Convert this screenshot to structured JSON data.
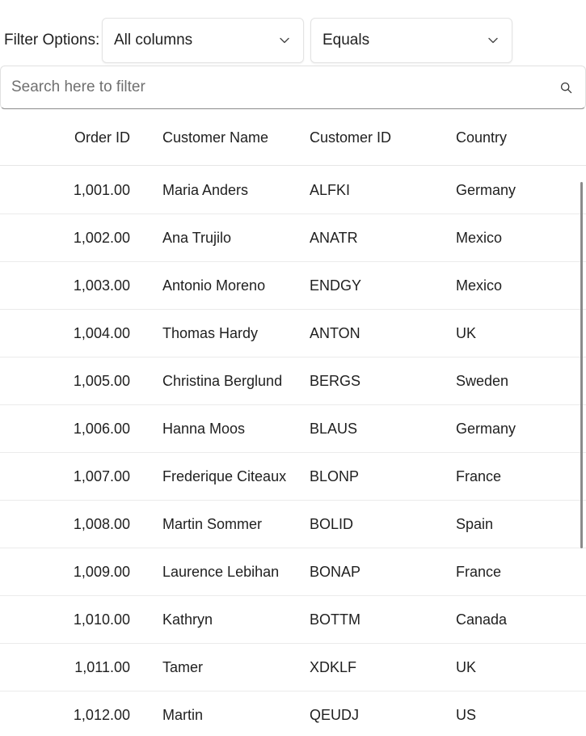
{
  "filter": {
    "label": "Filter Options:",
    "column_value": "All columns",
    "condition_value": "Equals"
  },
  "search": {
    "placeholder": "Search here to filter"
  },
  "grid": {
    "columns": [
      "Order ID",
      "Customer Name",
      "Customer ID",
      "Country"
    ],
    "rows": [
      [
        "1,001.00",
        "Maria Anders",
        "ALFKI",
        "Germany"
      ],
      [
        "1,002.00",
        "Ana Trujilo",
        "ANATR",
        "Mexico"
      ],
      [
        "1,003.00",
        "Antonio Moreno",
        "ENDGY",
        "Mexico"
      ],
      [
        "1,004.00",
        "Thomas Hardy",
        "ANTON",
        "UK"
      ],
      [
        "1,005.00",
        "Christina Berglund",
        "BERGS",
        "Sweden"
      ],
      [
        "1,006.00",
        "Hanna Moos",
        "BLAUS",
        "Germany"
      ],
      [
        "1,007.00",
        "Frederique Citeaux",
        "BLONP",
        "France"
      ],
      [
        "1,008.00",
        "Martin Sommer",
        "BOLID",
        "Spain"
      ],
      [
        "1,009.00",
        "Laurence Lebihan",
        "BONAP",
        "France"
      ],
      [
        "1,010.00",
        "Kathryn",
        "BOTTM",
        "Canada"
      ],
      [
        "1,011.00",
        "Tamer",
        "XDKLF",
        "UK"
      ],
      [
        "1,012.00",
        "Martin",
        "QEUDJ",
        "US"
      ]
    ]
  },
  "icons": {
    "dropdown": "chevron-down-icon",
    "search": "search-icon"
  }
}
